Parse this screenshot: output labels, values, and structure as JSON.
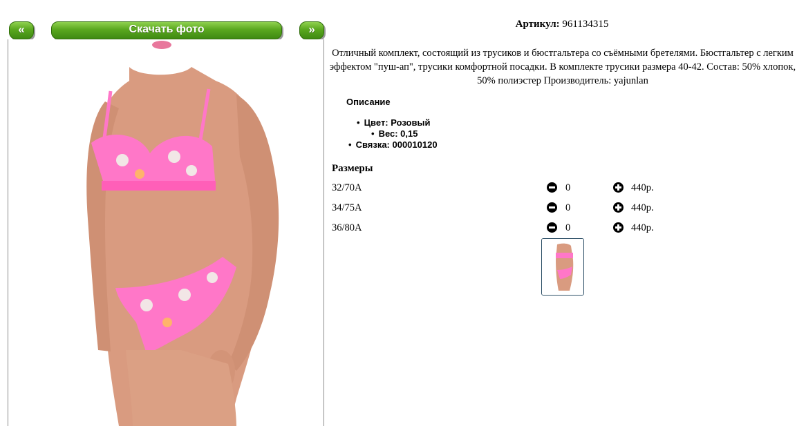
{
  "nav": {
    "prev_label": "«",
    "download_label": "Скачать фото",
    "next_label": "»"
  },
  "product": {
    "article_label": "Артикул:",
    "article_value": "961134315",
    "description": "Отличный комплект, состоящий из трусиков и бюстгальтера со съёмными бретелями. Бюстгальтер с легким эффектом \"пуш-ап\", трусики комфортной посадки. В комплекте трусики размера 40-42. Состав: 50% хлопок, 50% полиэстер Производитель: yajunlan"
  },
  "specs": {
    "title": "Описание",
    "items": [
      "Цвет: Розовый",
      "Вес: 0,15",
      "Связка: 000010120"
    ]
  },
  "sizes": {
    "title": "Размеры",
    "rows": [
      {
        "size": "32/70A",
        "qty": "0",
        "price": "440р."
      },
      {
        "size": "34/75A",
        "qty": "0",
        "price": "440р."
      },
      {
        "size": "36/80A",
        "qty": "0",
        "price": "440р."
      }
    ]
  },
  "colors": {
    "button_green": "#5aa71f",
    "lingerie_pink": "#ff77c8",
    "thumb_border": "#2c4e66"
  }
}
